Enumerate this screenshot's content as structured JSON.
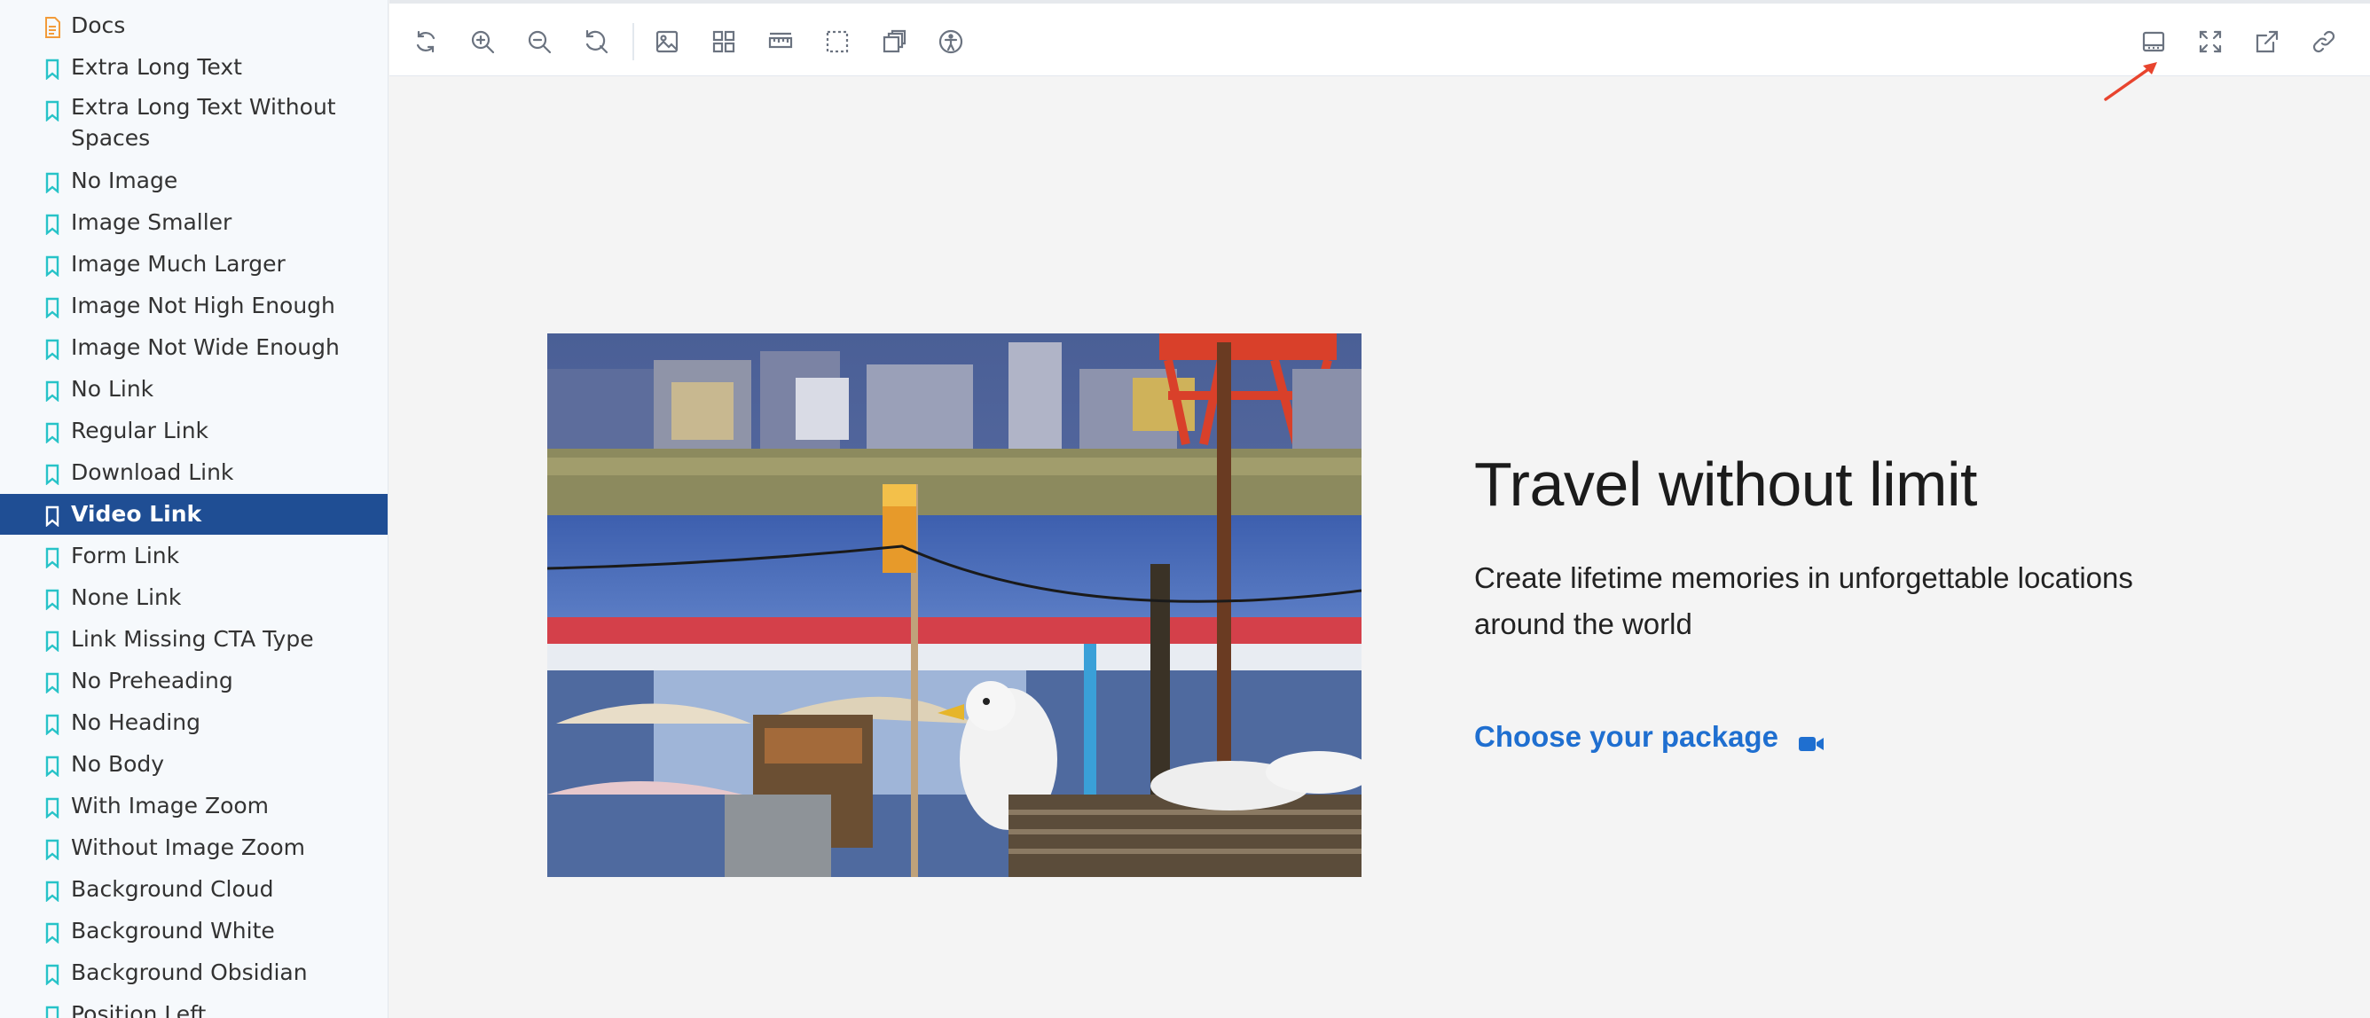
{
  "sidebar": {
    "items": [
      {
        "label": "Docs",
        "icon": "document-icon",
        "kind": "doc"
      },
      {
        "label": "Extra Long Text",
        "icon": "bookmark-icon",
        "kind": "story"
      },
      {
        "label": "Extra Long Text Without Spaces",
        "icon": "bookmark-icon",
        "kind": "story"
      },
      {
        "label": "No Image",
        "icon": "bookmark-icon",
        "kind": "story"
      },
      {
        "label": "Image Smaller",
        "icon": "bookmark-icon",
        "kind": "story"
      },
      {
        "label": "Image Much Larger",
        "icon": "bookmark-icon",
        "kind": "story"
      },
      {
        "label": "Image Not High Enough",
        "icon": "bookmark-icon",
        "kind": "story"
      },
      {
        "label": "Image Not Wide Enough",
        "icon": "bookmark-icon",
        "kind": "story"
      },
      {
        "label": "No Link",
        "icon": "bookmark-icon",
        "kind": "story"
      },
      {
        "label": "Regular Link",
        "icon": "bookmark-icon",
        "kind": "story"
      },
      {
        "label": "Download Link",
        "icon": "bookmark-icon",
        "kind": "story"
      },
      {
        "label": "Video Link",
        "icon": "bookmark-icon",
        "kind": "story",
        "selected": true
      },
      {
        "label": "Form Link",
        "icon": "bookmark-icon",
        "kind": "story"
      },
      {
        "label": "None Link",
        "icon": "bookmark-icon",
        "kind": "story"
      },
      {
        "label": "Link Missing CTA Type",
        "icon": "bookmark-icon",
        "kind": "story"
      },
      {
        "label": "No Preheading",
        "icon": "bookmark-icon",
        "kind": "story"
      },
      {
        "label": "No Heading",
        "icon": "bookmark-icon",
        "kind": "story"
      },
      {
        "label": "No Body",
        "icon": "bookmark-icon",
        "kind": "story"
      },
      {
        "label": "With Image Zoom",
        "icon": "bookmark-icon",
        "kind": "story"
      },
      {
        "label": "Without Image Zoom",
        "icon": "bookmark-icon",
        "kind": "story"
      },
      {
        "label": "Background Cloud",
        "icon": "bookmark-icon",
        "kind": "story"
      },
      {
        "label": "Background White",
        "icon": "bookmark-icon",
        "kind": "story"
      },
      {
        "label": "Background Obsidian",
        "icon": "bookmark-icon",
        "kind": "story"
      },
      {
        "label": "Position Left",
        "icon": "bookmark-icon",
        "kind": "story"
      }
    ]
  },
  "toolbar": {
    "left_tools": [
      "reload-icon",
      "zoom-in-icon",
      "zoom-out-icon",
      "reset-zoom-icon",
      "background-image-icon",
      "grid-icon",
      "ruler-icon",
      "outline-icon",
      "viewport-icon",
      "accessibility-icon"
    ],
    "right_tools": [
      "addons-panel-icon",
      "fullscreen-icon",
      "open-new-tab-icon",
      "copy-link-icon"
    ]
  },
  "hero": {
    "title": "Travel without limit",
    "body": "Create lifetime memories in unforgettable locations around the world",
    "cta_label": "Choose your package",
    "cta_icon": "video-camera-icon"
  },
  "colors": {
    "accent": "#1f4e94",
    "link": "#1f6fd0",
    "story_icon": "#27c3c8",
    "doc_icon": "#f29b3a",
    "annotation": "#e8442e"
  }
}
